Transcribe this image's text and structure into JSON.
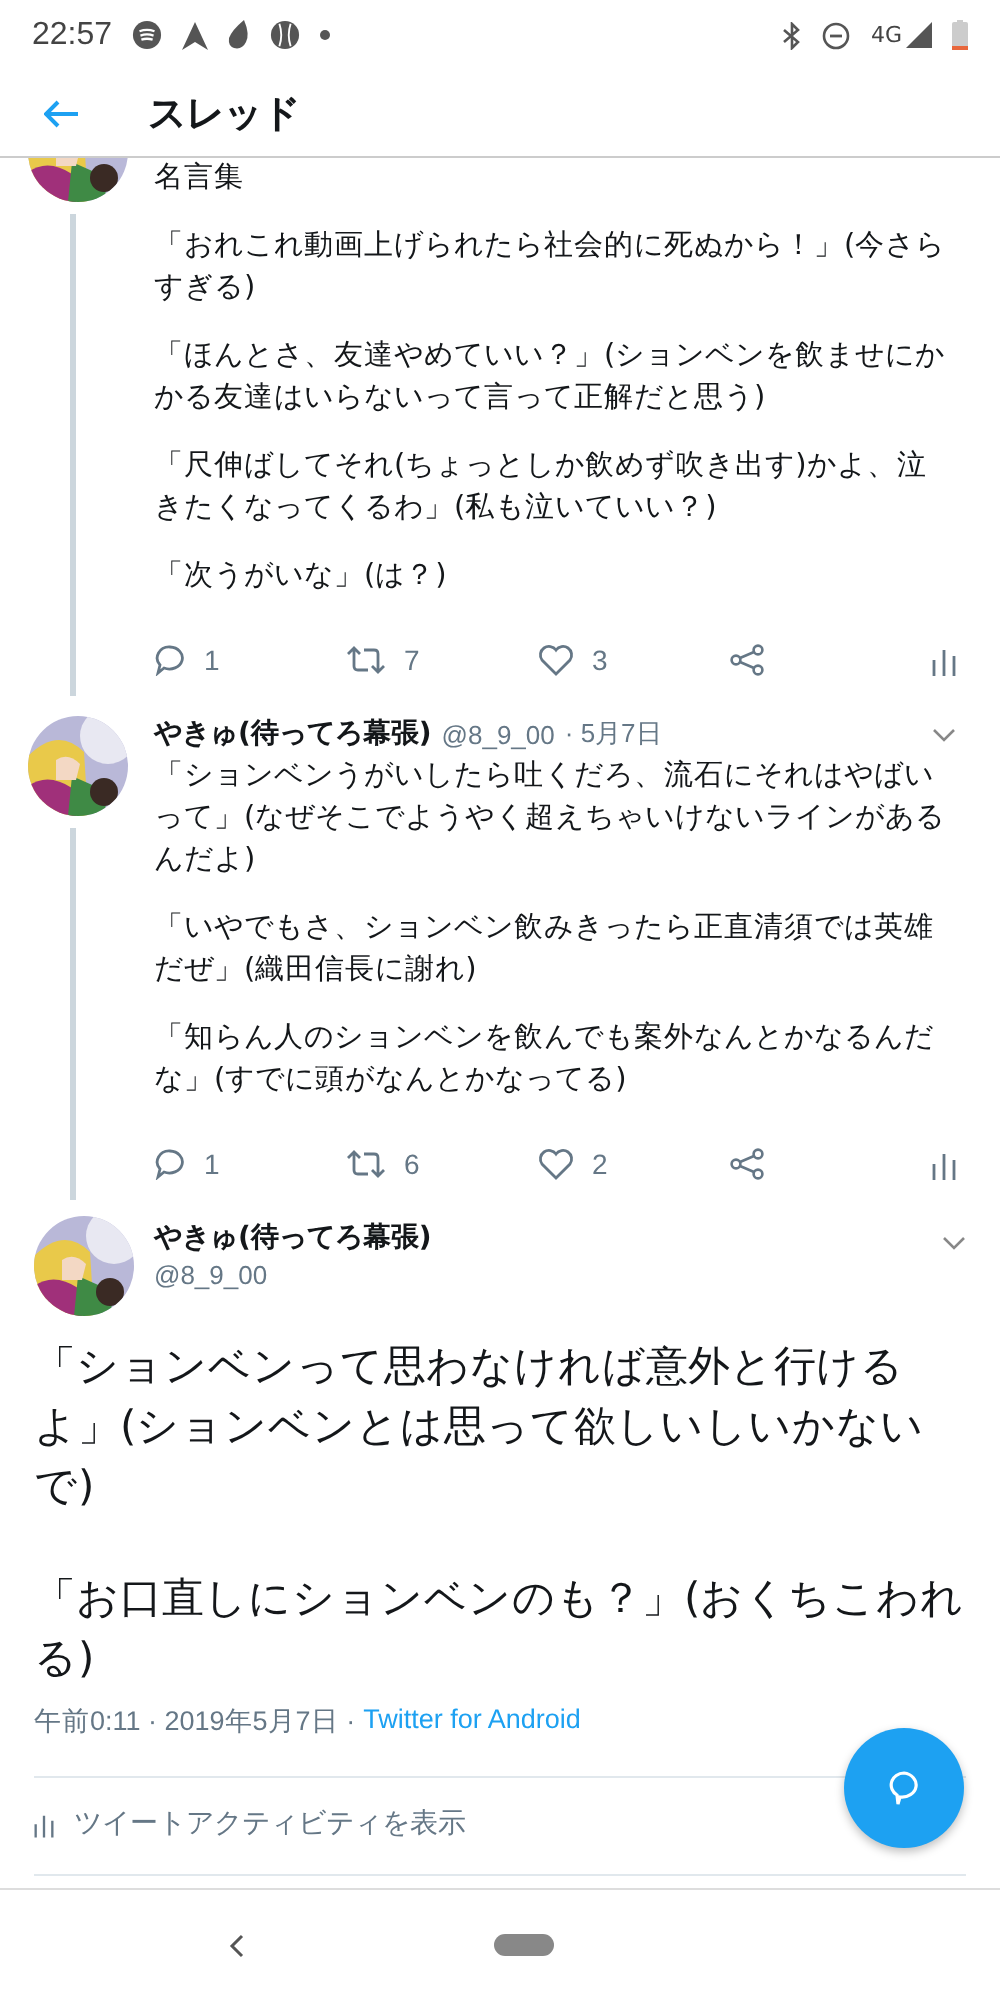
{
  "status_bar": {
    "time": "22:57",
    "network": "4G"
  },
  "header": {
    "title": "スレッド"
  },
  "thread": [
    {
      "kind": "partial",
      "paragraphs": [
        "名言集",
        "「おれこれ動画上げられたら社会的に死ぬから！」(今さらすぎる)",
        "「ほんとさ、友達やめていい？」(ションベンを飲ませにかかる友達はいらないって言って正解だと思う)",
        "「尺伸ばしてそれ(ちょっとしか飲めず吹き出す)かよ、泣きたくなってくるわ」(私も泣いていい？)",
        "「次うがいな」(は？)"
      ],
      "replies": "1",
      "retweets": "7",
      "likes": "3"
    },
    {
      "kind": "full",
      "name": "やきゅ(待ってろ幕張)",
      "handle": "@8_9_00",
      "date": "· 5月7日",
      "paragraphs": [
        "「ションベンうがいしたら吐くだろ、流石にそれはやばいって」(なぜそこでようやく超えちゃいけないラインがあるんだよ)",
        "「いやでもさ、ションベン飲みきったら正直清須では英雄だぜ」(織田信長に謝れ)",
        "「知らん人のションベンを飲んでも案外なんとかなるんだな」(すでに頭がなんとかなってる)"
      ],
      "replies": "1",
      "retweets": "6",
      "likes": "2"
    }
  ],
  "main_tweet": {
    "name": "やきゅ(待ってろ幕張)",
    "handle": "@8_9_00",
    "paragraphs": [
      "「ションベンって思わなければ意外と行けるよ」(ションベンとは思って欲しいしいかないで)",
      "「お口直しにションベンのも？」(おくちこわれる)"
    ],
    "timestamp": "午前0:11 · 2019年5月7日 ·",
    "source": "Twitter for Android",
    "activity": "ツイートアクティビティを表示"
  }
}
